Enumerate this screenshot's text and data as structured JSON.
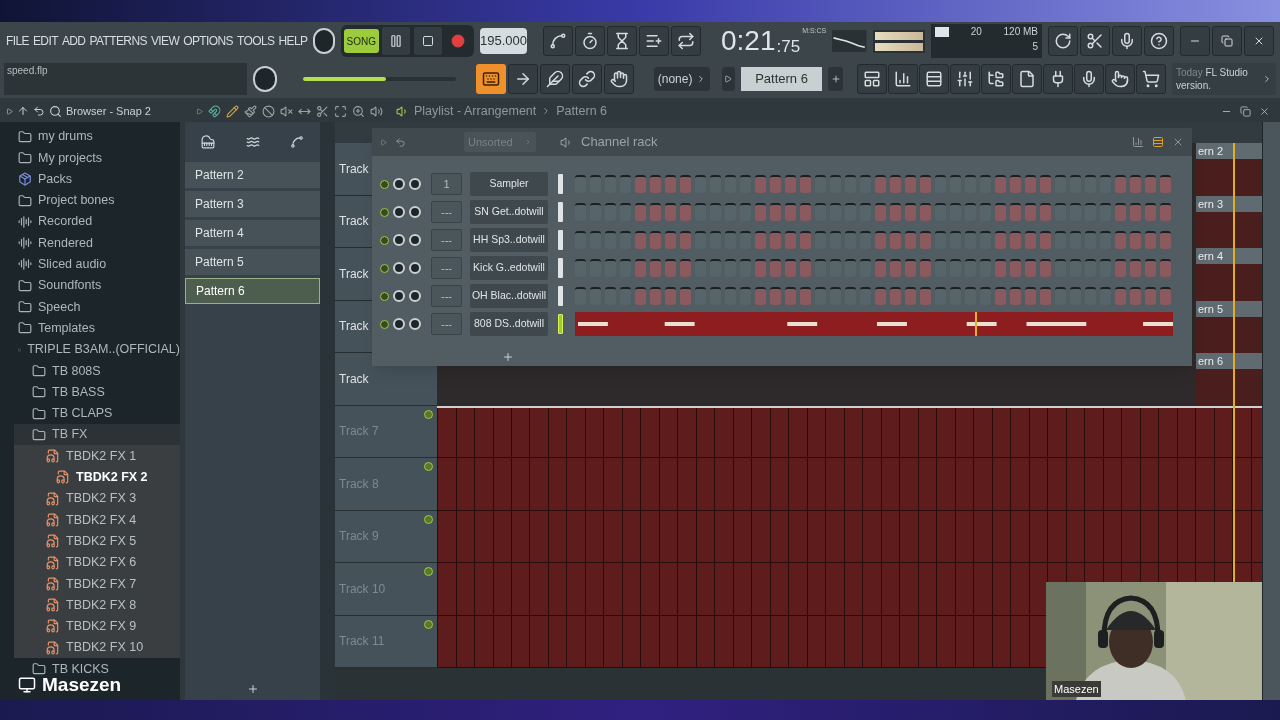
{
  "menu": [
    "FILE",
    "EDIT",
    "ADD",
    "PATTERNS",
    "VIEW",
    "OPTIONS",
    "TOOLS",
    "HELP"
  ],
  "transport": {
    "mode": "SONG",
    "song_mode": true
  },
  "tempo": "195.000",
  "time": {
    "value": "0:21",
    "fraction": ":75",
    "unit": "M:S:CS"
  },
  "cpu": {
    "polyphony": "20",
    "memory": "120 MB",
    "voices": "5"
  },
  "hint": "speed.flp",
  "master_volume": {
    "level": 0.54
  },
  "typing_keyboard": {
    "on": true
  },
  "snap": "(none)",
  "pattern_selector": "Pattern 6",
  "news": {
    "date": "Today",
    "text": "FL Studio version."
  },
  "browser": {
    "title": "Browser - Snap 2",
    "items": [
      {
        "name": "my drums",
        "kind": "folder"
      },
      {
        "name": "My projects",
        "kind": "folder"
      },
      {
        "name": "Packs",
        "kind": "pack"
      },
      {
        "name": "Project bones",
        "kind": "folder"
      },
      {
        "name": "Recorded",
        "kind": "audio"
      },
      {
        "name": "Rendered",
        "kind": "audio"
      },
      {
        "name": "Sliced audio",
        "kind": "audio"
      },
      {
        "name": "Soundfonts",
        "kind": "folder"
      },
      {
        "name": "Speech",
        "kind": "folder"
      },
      {
        "name": "Templates",
        "kind": "folder"
      },
      {
        "name": "TRIPLE B3AM..(OFFICIAL)",
        "kind": "folder",
        "children": [
          {
            "name": "TB 808S",
            "kind": "folder"
          },
          {
            "name": "TB BASS",
            "kind": "folder"
          },
          {
            "name": "TB CLAPS",
            "kind": "folder"
          },
          {
            "name": "TB FX",
            "kind": "folder",
            "children": [
              {
                "name": "TBDK2 FX 1",
                "kind": "file",
                "selected": false
              },
              {
                "name": "TBDK2 FX 2",
                "kind": "file",
                "selected": true
              },
              {
                "name": "TBDK2 FX 3",
                "kind": "file",
                "selected": false
              },
              {
                "name": "TBDK2 FX 4",
                "kind": "file",
                "selected": false
              },
              {
                "name": "TBDK2 FX 5",
                "kind": "file",
                "selected": false
              },
              {
                "name": "TBDK2 FX 6",
                "kind": "file",
                "selected": false
              },
              {
                "name": "TBDK2 FX 7",
                "kind": "file",
                "selected": false
              },
              {
                "name": "TBDK2 FX 8",
                "kind": "file",
                "selected": false
              },
              {
                "name": "TBDK2 FX 9",
                "kind": "file",
                "selected": false
              },
              {
                "name": "TBDK2 FX 10",
                "kind": "file",
                "selected": false
              }
            ]
          },
          {
            "name": "TB KICKS",
            "kind": "folder"
          }
        ]
      }
    ]
  },
  "patterns": [
    {
      "name": "Pattern 2",
      "selected": false
    },
    {
      "name": "Pattern 3",
      "selected": false
    },
    {
      "name": "Pattern 4",
      "selected": false
    },
    {
      "name": "Pattern 5",
      "selected": false
    },
    {
      "name": "Pattern 6",
      "selected": true
    }
  ],
  "playlist": {
    "title": "Playlist - Arrangement",
    "pattern": "Pattern 6",
    "tracks": [
      {
        "name": "Track",
        "kind": "clip",
        "clip": "ern 2"
      },
      {
        "name": "Track",
        "kind": "clip",
        "clip": "ern 3"
      },
      {
        "name": "Track",
        "kind": "clip",
        "clip": "ern 4"
      },
      {
        "name": "Track",
        "kind": "clip",
        "clip": "ern 5"
      },
      {
        "name": "Track",
        "kind": "clip",
        "clip": "ern 6"
      },
      {
        "name": "Track 7",
        "kind": "filled"
      },
      {
        "name": "Track 8",
        "kind": "filled"
      },
      {
        "name": "Track 9",
        "kind": "filled"
      },
      {
        "name": "Track 10",
        "kind": "filled"
      },
      {
        "name": "Track 11",
        "kind": "filled"
      }
    ]
  },
  "channel_rack": {
    "filter": "Unsorted",
    "title": "Channel rack",
    "channels": [
      {
        "name": "Sampler",
        "target": "1",
        "kind": "steps",
        "selected": false
      },
      {
        "name": "SN Get..dotwill",
        "target": "---",
        "kind": "steps",
        "selected": false
      },
      {
        "name": "HH Sp3..dotwill",
        "target": "---",
        "kind": "steps",
        "selected": false
      },
      {
        "name": "Kick G..edotwill",
        "target": "---",
        "kind": "steps",
        "selected": false
      },
      {
        "name": "OH Blac..dotwill",
        "target": "---",
        "kind": "steps",
        "selected": false
      },
      {
        "name": "808 DS..dotwill",
        "target": "---",
        "kind": "notes",
        "selected": true
      }
    ]
  },
  "webcam": {
    "kind": "picture",
    "name": "Masezen"
  },
  "streamer": "Masezen"
}
